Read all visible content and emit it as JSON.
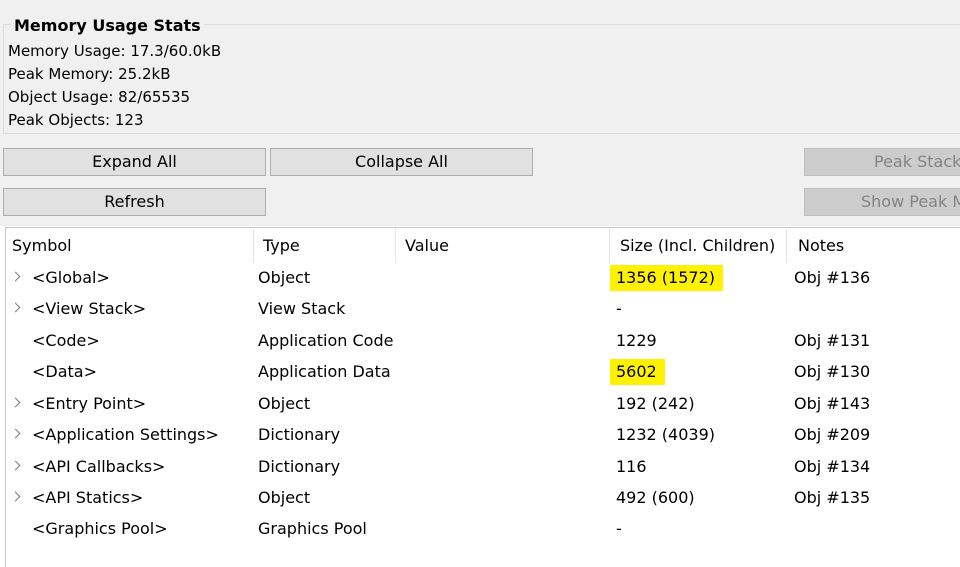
{
  "stats": {
    "title": "Memory Usage Stats",
    "memory_usage": "Memory Usage: 17.3/60.0kB",
    "peak_memory": "Peak Memory: 25.2kB",
    "object_usage": "Object Usage: 82/65535",
    "peak_objects": "Peak Objects: 123"
  },
  "buttons": {
    "expand_all": "Expand All",
    "collapse_all": "Collapse All",
    "refresh": "Refresh",
    "peak_stack": "Peak Stack T",
    "show_peak": "Show Peak M"
  },
  "table": {
    "columns": [
      "Symbol",
      "Type",
      "Value",
      "Size (Incl. Children)",
      "Notes"
    ],
    "rows": [
      {
        "symbol": "<Global>",
        "type": "Object",
        "value": "",
        "size": "1356 (1572)",
        "notes": "Obj #136",
        "expandable": true,
        "highlighted": true
      },
      {
        "symbol": "<View Stack>",
        "type": "View Stack",
        "value": "",
        "size": "-",
        "notes": "",
        "expandable": true,
        "highlighted": false
      },
      {
        "symbol": "<Code>",
        "type": "Application Code",
        "value": "",
        "size": "1229",
        "notes": "Obj #131",
        "expandable": false,
        "highlighted": false
      },
      {
        "symbol": "<Data>",
        "type": "Application Data",
        "value": "",
        "size": "5602",
        "notes": "Obj #130",
        "expandable": false,
        "highlighted": true
      },
      {
        "symbol": "<Entry Point>",
        "type": "Object",
        "value": "",
        "size": "192 (242)",
        "notes": "Obj #143",
        "expandable": true,
        "highlighted": false
      },
      {
        "symbol": "<Application Settings>",
        "type": "Dictionary",
        "value": "",
        "size": "1232 (4039)",
        "notes": "Obj #209",
        "expandable": true,
        "highlighted": false
      },
      {
        "symbol": "<API Callbacks>",
        "type": "Dictionary",
        "value": "",
        "size": "116",
        "notes": "Obj #134",
        "expandable": true,
        "highlighted": false
      },
      {
        "symbol": "<API Statics>",
        "type": "Object",
        "value": "",
        "size": "492 (600)",
        "notes": "Obj #135",
        "expandable": true,
        "highlighted": false
      },
      {
        "symbol": "<Graphics Pool>",
        "type": "Graphics Pool",
        "value": "",
        "size": "-",
        "notes": "",
        "expandable": false,
        "highlighted": false
      }
    ]
  },
  "colors": {
    "highlight": "#fff200",
    "panel_bg": "#f0f0f0",
    "button_bg": "#e1e1e1"
  }
}
